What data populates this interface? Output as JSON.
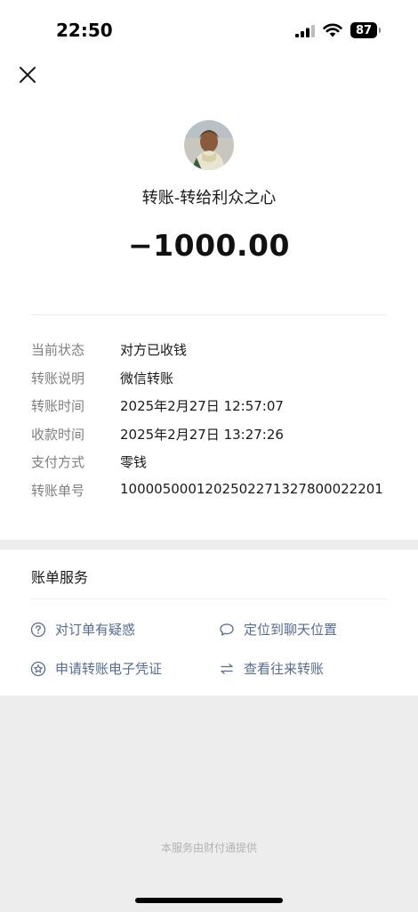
{
  "status_bar": {
    "time": "22:50",
    "battery": "87"
  },
  "header": {
    "close_icon": "close-icon"
  },
  "transfer": {
    "title": "转账-转给利众之心",
    "amount": "−1000.00"
  },
  "details": [
    {
      "label": "当前状态",
      "value": "对方已收钱"
    },
    {
      "label": "转账说明",
      "value": "微信转账"
    },
    {
      "label": "转账时间",
      "value": "2025年2月27日 12:57:07"
    },
    {
      "label": "收款时间",
      "value": "2025年2月27日 13:27:26"
    },
    {
      "label": "支付方式",
      "value": "零钱"
    },
    {
      "label": "转账单号",
      "value": "1000050001202502271327800022201"
    }
  ],
  "bill_services": {
    "title": "账单服务",
    "items": [
      {
        "label": "对订单有疑惑",
        "icon": "question-circle-icon"
      },
      {
        "label": "定位到聊天位置",
        "icon": "chat-bubble-icon"
      },
      {
        "label": "申请转账电子凭证",
        "icon": "badge-star-icon"
      },
      {
        "label": "查看往来转账",
        "icon": "exchange-arrows-icon"
      }
    ]
  },
  "footer": {
    "text": "本服务由财付通提供"
  },
  "colors": {
    "link": "#576b95",
    "label": "#7f7f7f",
    "background": "#ededed"
  }
}
